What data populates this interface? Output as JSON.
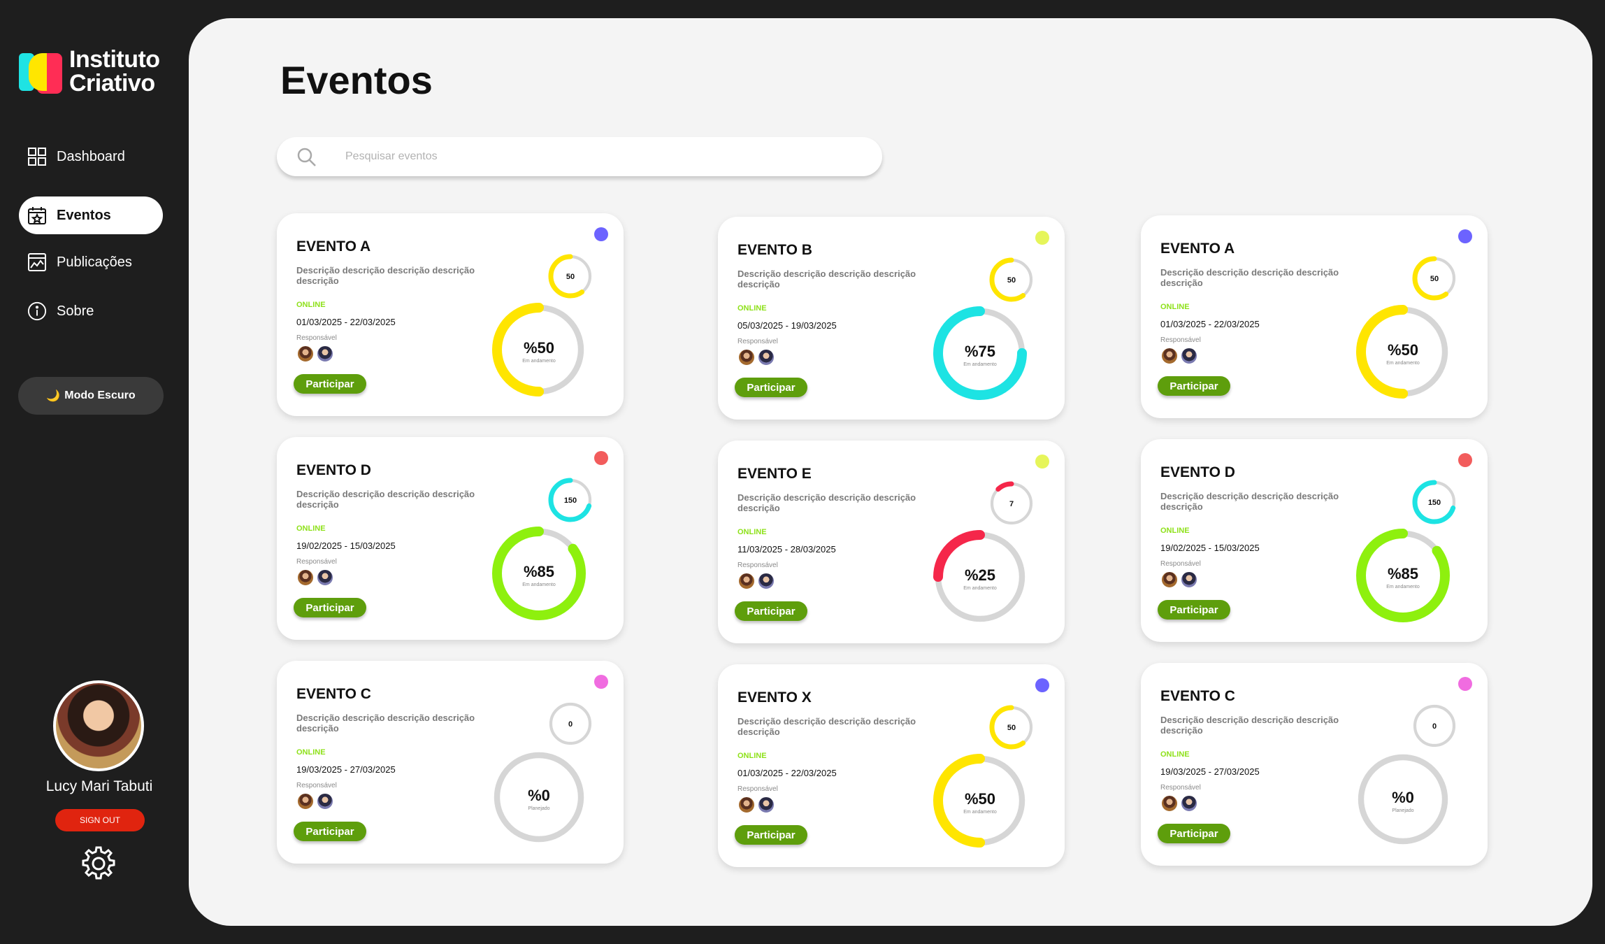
{
  "app": {
    "logo_line1": "Instituto",
    "logo_line2": "Criativo"
  },
  "nav": [
    {
      "label": "Dashboard",
      "icon": "dashboard-icon",
      "active": false
    },
    {
      "label": "Eventos",
      "icon": "calendar-star-icon",
      "active": true
    },
    {
      "label": "Publicações",
      "icon": "chart-image-icon",
      "active": false
    },
    {
      "label": "Sobre",
      "icon": "info-icon",
      "active": false
    }
  ],
  "dark_mode_label": "Modo Escuro",
  "user": {
    "name": "Lucy Mari Tabuti",
    "signout_label": "SIGN OUT"
  },
  "page_title": "Eventos",
  "search": {
    "placeholder": "Pesquisar eventos"
  },
  "colors": {
    "yellow": "#ffe500",
    "cyan": "#1de3e3",
    "green": "#8ef00e",
    "red": "#f5274a",
    "grey": "#d0d0d0",
    "purple": "#6c63ff",
    "lime": "#e6f55a",
    "coral": "#f25c5c",
    "pink": "#f06ce0"
  },
  "cards": [
    {
      "title": "EVENTO A",
      "desc": "Descrição descrição descrição descrição descrição",
      "mode": "ONLINE",
      "dates": "01/03/2025 -  22/03/2025",
      "resp": "Responsável",
      "button": "Participar",
      "dot": "#6c63ff",
      "small_value": "50",
      "small_frac": 0.6,
      "small_color": "#ffe500",
      "percent": "%50",
      "status": "Em andamento",
      "big_frac": 0.5,
      "big_color": "#ffe500"
    },
    {
      "title": "EVENTO B",
      "desc": "Descrição descrição descrição descrição descrição",
      "mode": "ONLINE",
      "dates": "05/03/2025 -  19/03/2025",
      "resp": "Responsável",
      "button": "Participar",
      "dot": "#e6f55a",
      "small_value": "50",
      "small_frac": 0.6,
      "small_color": "#ffe500",
      "percent": "%75",
      "status": "Em andamento",
      "big_frac": 0.75,
      "big_color": "#1de3e3"
    },
    {
      "title": "EVENTO A",
      "desc": "Descrição descrição descrição descrição descrição",
      "mode": "ONLINE",
      "dates": "01/03/2025 -  22/03/2025",
      "resp": "Responsável",
      "button": "Participar",
      "dot": "#6c63ff",
      "small_value": "50",
      "small_frac": 0.6,
      "small_color": "#ffe500",
      "percent": "%50",
      "status": "Em andamento",
      "big_frac": 0.5,
      "big_color": "#ffe500"
    },
    {
      "title": "EVENTO D",
      "desc": "Descrição descrição descrição descrição descrição",
      "mode": "ONLINE",
      "dates": "19/02/2025 -  15/03/2025",
      "resp": "Responsável",
      "button": "Participar",
      "dot": "#f25c5c",
      "small_value": "150",
      "small_frac": 0.7,
      "small_color": "#1de3e3",
      "percent": "%85",
      "status": "Em andamento",
      "big_frac": 0.85,
      "big_color": "#8ef00e"
    },
    {
      "title": "EVENTO E",
      "desc": "Descrição descrição descrição descrição descrição",
      "mode": "ONLINE",
      "dates": "11/03/2025 -  28/03/2025",
      "resp": "Responsável",
      "button": "Participar",
      "dot": "#e6f55a",
      "small_value": "7",
      "small_frac": 0.12,
      "small_color": "#f5274a",
      "percent": "%25",
      "status": "Em andamento",
      "big_frac": 0.25,
      "big_color": "#f5274a"
    },
    {
      "title": "EVENTO D",
      "desc": "Descrição descrição descrição descrição descrição",
      "mode": "ONLINE",
      "dates": "19/02/2025 -  15/03/2025",
      "resp": "Responsável",
      "button": "Participar",
      "dot": "#f25c5c",
      "small_value": "150",
      "small_frac": 0.7,
      "small_color": "#1de3e3",
      "percent": "%85",
      "status": "Em andamento",
      "big_frac": 0.85,
      "big_color": "#8ef00e"
    },
    {
      "title": "EVENTO C",
      "desc": "Descrição descrição descrição descrição descrição",
      "mode": "ONLINE",
      "dates": "19/03/2025 -  27/03/2025",
      "resp": "Responsável",
      "button": "Participar",
      "dot": "#f06ce0",
      "small_value": "0",
      "small_frac": 0,
      "small_color": "#d0d0d0",
      "percent": "%0",
      "status": "Planejado",
      "big_frac": 0,
      "big_color": "#d0d0d0"
    },
    {
      "title": "EVENTO X",
      "desc": "Descrição descrição descrição descrição descrição",
      "mode": "ONLINE",
      "dates": "01/03/2025 -  22/03/2025",
      "resp": "Responsável",
      "button": "Participar",
      "dot": "#6c63ff",
      "small_value": "50",
      "small_frac": 0.6,
      "small_color": "#ffe500",
      "percent": "%50",
      "status": "Em andamento",
      "big_frac": 0.5,
      "big_color": "#ffe500"
    },
    {
      "title": "EVENTO C",
      "desc": "Descrição descrição descrição descrição descrição",
      "mode": "ONLINE",
      "dates": "19/03/2025 -  27/03/2025",
      "resp": "Responsável",
      "button": "Participar",
      "dot": "#f06ce0",
      "small_value": "0",
      "small_frac": 0,
      "small_color": "#d0d0d0",
      "percent": "%0",
      "status": "Planejado",
      "big_frac": 0,
      "big_color": "#d0d0d0"
    }
  ]
}
